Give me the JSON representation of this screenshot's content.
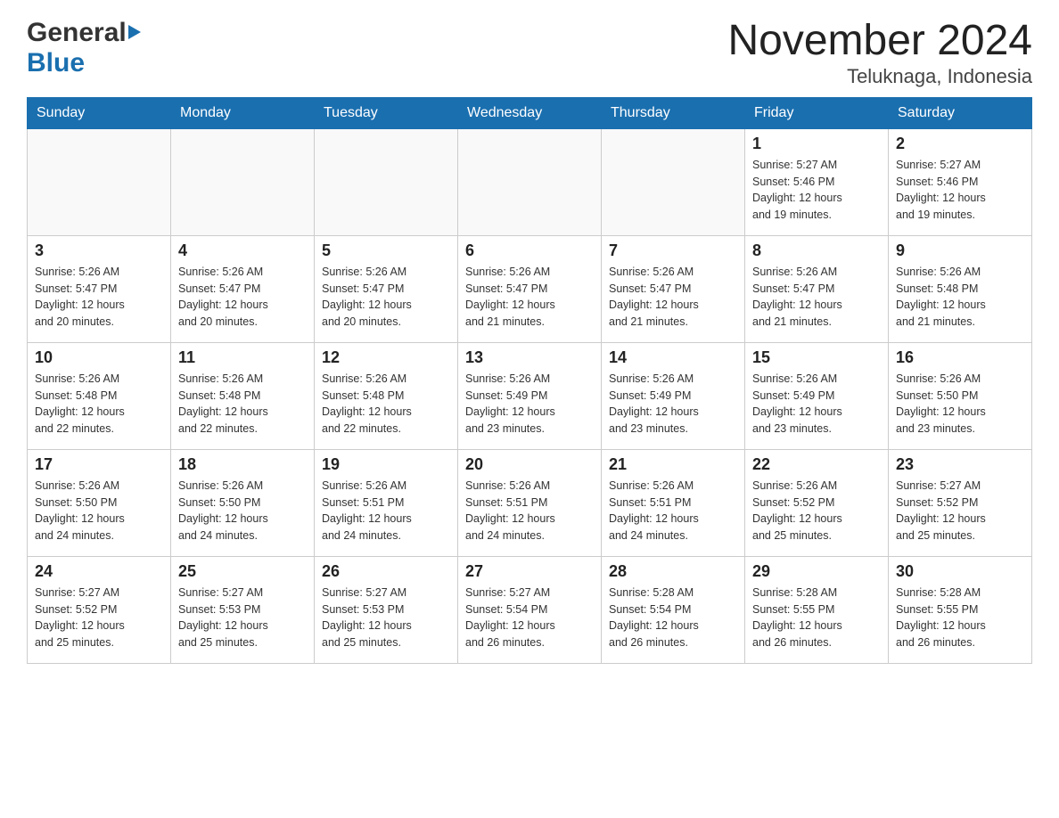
{
  "header": {
    "logo_general": "General",
    "logo_blue": "Blue",
    "title": "November 2024",
    "subtitle": "Teluknaga, Indonesia"
  },
  "weekdays": [
    "Sunday",
    "Monday",
    "Tuesday",
    "Wednesday",
    "Thursday",
    "Friday",
    "Saturday"
  ],
  "weeks": [
    [
      {
        "day": "",
        "info": ""
      },
      {
        "day": "",
        "info": ""
      },
      {
        "day": "",
        "info": ""
      },
      {
        "day": "",
        "info": ""
      },
      {
        "day": "",
        "info": ""
      },
      {
        "day": "1",
        "info": "Sunrise: 5:27 AM\nSunset: 5:46 PM\nDaylight: 12 hours\nand 19 minutes."
      },
      {
        "day": "2",
        "info": "Sunrise: 5:27 AM\nSunset: 5:46 PM\nDaylight: 12 hours\nand 19 minutes."
      }
    ],
    [
      {
        "day": "3",
        "info": "Sunrise: 5:26 AM\nSunset: 5:47 PM\nDaylight: 12 hours\nand 20 minutes."
      },
      {
        "day": "4",
        "info": "Sunrise: 5:26 AM\nSunset: 5:47 PM\nDaylight: 12 hours\nand 20 minutes."
      },
      {
        "day": "5",
        "info": "Sunrise: 5:26 AM\nSunset: 5:47 PM\nDaylight: 12 hours\nand 20 minutes."
      },
      {
        "day": "6",
        "info": "Sunrise: 5:26 AM\nSunset: 5:47 PM\nDaylight: 12 hours\nand 21 minutes."
      },
      {
        "day": "7",
        "info": "Sunrise: 5:26 AM\nSunset: 5:47 PM\nDaylight: 12 hours\nand 21 minutes."
      },
      {
        "day": "8",
        "info": "Sunrise: 5:26 AM\nSunset: 5:47 PM\nDaylight: 12 hours\nand 21 minutes."
      },
      {
        "day": "9",
        "info": "Sunrise: 5:26 AM\nSunset: 5:48 PM\nDaylight: 12 hours\nand 21 minutes."
      }
    ],
    [
      {
        "day": "10",
        "info": "Sunrise: 5:26 AM\nSunset: 5:48 PM\nDaylight: 12 hours\nand 22 minutes."
      },
      {
        "day": "11",
        "info": "Sunrise: 5:26 AM\nSunset: 5:48 PM\nDaylight: 12 hours\nand 22 minutes."
      },
      {
        "day": "12",
        "info": "Sunrise: 5:26 AM\nSunset: 5:48 PM\nDaylight: 12 hours\nand 22 minutes."
      },
      {
        "day": "13",
        "info": "Sunrise: 5:26 AM\nSunset: 5:49 PM\nDaylight: 12 hours\nand 23 minutes."
      },
      {
        "day": "14",
        "info": "Sunrise: 5:26 AM\nSunset: 5:49 PM\nDaylight: 12 hours\nand 23 minutes."
      },
      {
        "day": "15",
        "info": "Sunrise: 5:26 AM\nSunset: 5:49 PM\nDaylight: 12 hours\nand 23 minutes."
      },
      {
        "day": "16",
        "info": "Sunrise: 5:26 AM\nSunset: 5:50 PM\nDaylight: 12 hours\nand 23 minutes."
      }
    ],
    [
      {
        "day": "17",
        "info": "Sunrise: 5:26 AM\nSunset: 5:50 PM\nDaylight: 12 hours\nand 24 minutes."
      },
      {
        "day": "18",
        "info": "Sunrise: 5:26 AM\nSunset: 5:50 PM\nDaylight: 12 hours\nand 24 minutes."
      },
      {
        "day": "19",
        "info": "Sunrise: 5:26 AM\nSunset: 5:51 PM\nDaylight: 12 hours\nand 24 minutes."
      },
      {
        "day": "20",
        "info": "Sunrise: 5:26 AM\nSunset: 5:51 PM\nDaylight: 12 hours\nand 24 minutes."
      },
      {
        "day": "21",
        "info": "Sunrise: 5:26 AM\nSunset: 5:51 PM\nDaylight: 12 hours\nand 24 minutes."
      },
      {
        "day": "22",
        "info": "Sunrise: 5:26 AM\nSunset: 5:52 PM\nDaylight: 12 hours\nand 25 minutes."
      },
      {
        "day": "23",
        "info": "Sunrise: 5:27 AM\nSunset: 5:52 PM\nDaylight: 12 hours\nand 25 minutes."
      }
    ],
    [
      {
        "day": "24",
        "info": "Sunrise: 5:27 AM\nSunset: 5:52 PM\nDaylight: 12 hours\nand 25 minutes."
      },
      {
        "day": "25",
        "info": "Sunrise: 5:27 AM\nSunset: 5:53 PM\nDaylight: 12 hours\nand 25 minutes."
      },
      {
        "day": "26",
        "info": "Sunrise: 5:27 AM\nSunset: 5:53 PM\nDaylight: 12 hours\nand 25 minutes."
      },
      {
        "day": "27",
        "info": "Sunrise: 5:27 AM\nSunset: 5:54 PM\nDaylight: 12 hours\nand 26 minutes."
      },
      {
        "day": "28",
        "info": "Sunrise: 5:28 AM\nSunset: 5:54 PM\nDaylight: 12 hours\nand 26 minutes."
      },
      {
        "day": "29",
        "info": "Sunrise: 5:28 AM\nSunset: 5:55 PM\nDaylight: 12 hours\nand 26 minutes."
      },
      {
        "day": "30",
        "info": "Sunrise: 5:28 AM\nSunset: 5:55 PM\nDaylight: 12 hours\nand 26 minutes."
      }
    ]
  ]
}
